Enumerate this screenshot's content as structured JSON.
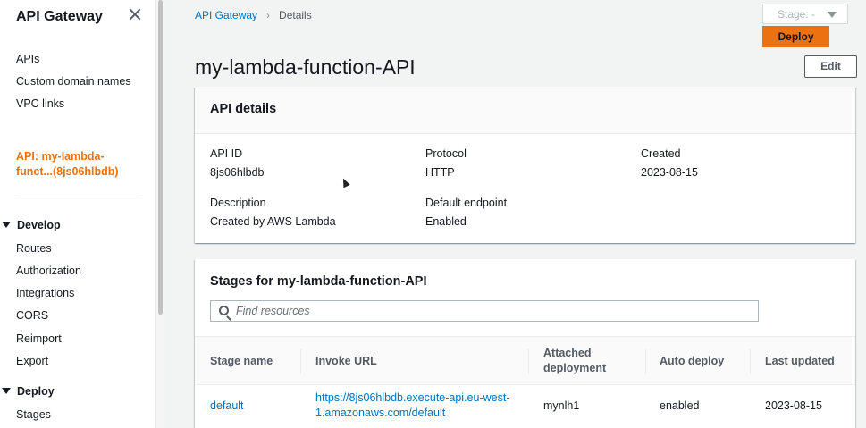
{
  "sidebar": {
    "title": "API Gateway",
    "links": [
      "APIs",
      "Custom domain names",
      "VPC links"
    ],
    "current_api": "API: my-lambda-funct...(8js06hlbdb)",
    "develop": {
      "label": "Develop",
      "items": [
        "Routes",
        "Authorization",
        "Integrations",
        "CORS",
        "Reimport",
        "Export"
      ]
    },
    "deploy": {
      "label": "Deploy",
      "items": [
        "Stages"
      ]
    }
  },
  "breadcrumb": [
    "API Gateway",
    "Details"
  ],
  "header": {
    "title": "my-lambda-function-API",
    "stage_select": "Stage: -",
    "deploy_label": "Deploy",
    "edit_label": "Edit"
  },
  "details": {
    "heading": "API details",
    "fields": [
      {
        "label": "API ID",
        "value": "8js06hlbdb"
      },
      {
        "label": "Protocol",
        "value": "HTTP"
      },
      {
        "label": "Created",
        "value": "2023-08-15"
      },
      {
        "label": "Description",
        "value": "Created by AWS Lambda"
      },
      {
        "label": "Default endpoint",
        "value": "Enabled"
      }
    ]
  },
  "stages": {
    "heading": "Stages for my-lambda-function-API",
    "search_placeholder": "Find resources",
    "columns": [
      "Stage name",
      "Invoke URL",
      "Attached deployment",
      "Auto deploy",
      "Last updated"
    ],
    "rows": [
      {
        "stage_name": "default",
        "invoke_url": "https://8js06hlbdb.execute-api.eu-west-1.amazonaws.com/default",
        "deployment": "mynlh1",
        "auto_deploy": "enabled",
        "last_updated": "2023-08-15"
      }
    ]
  }
}
